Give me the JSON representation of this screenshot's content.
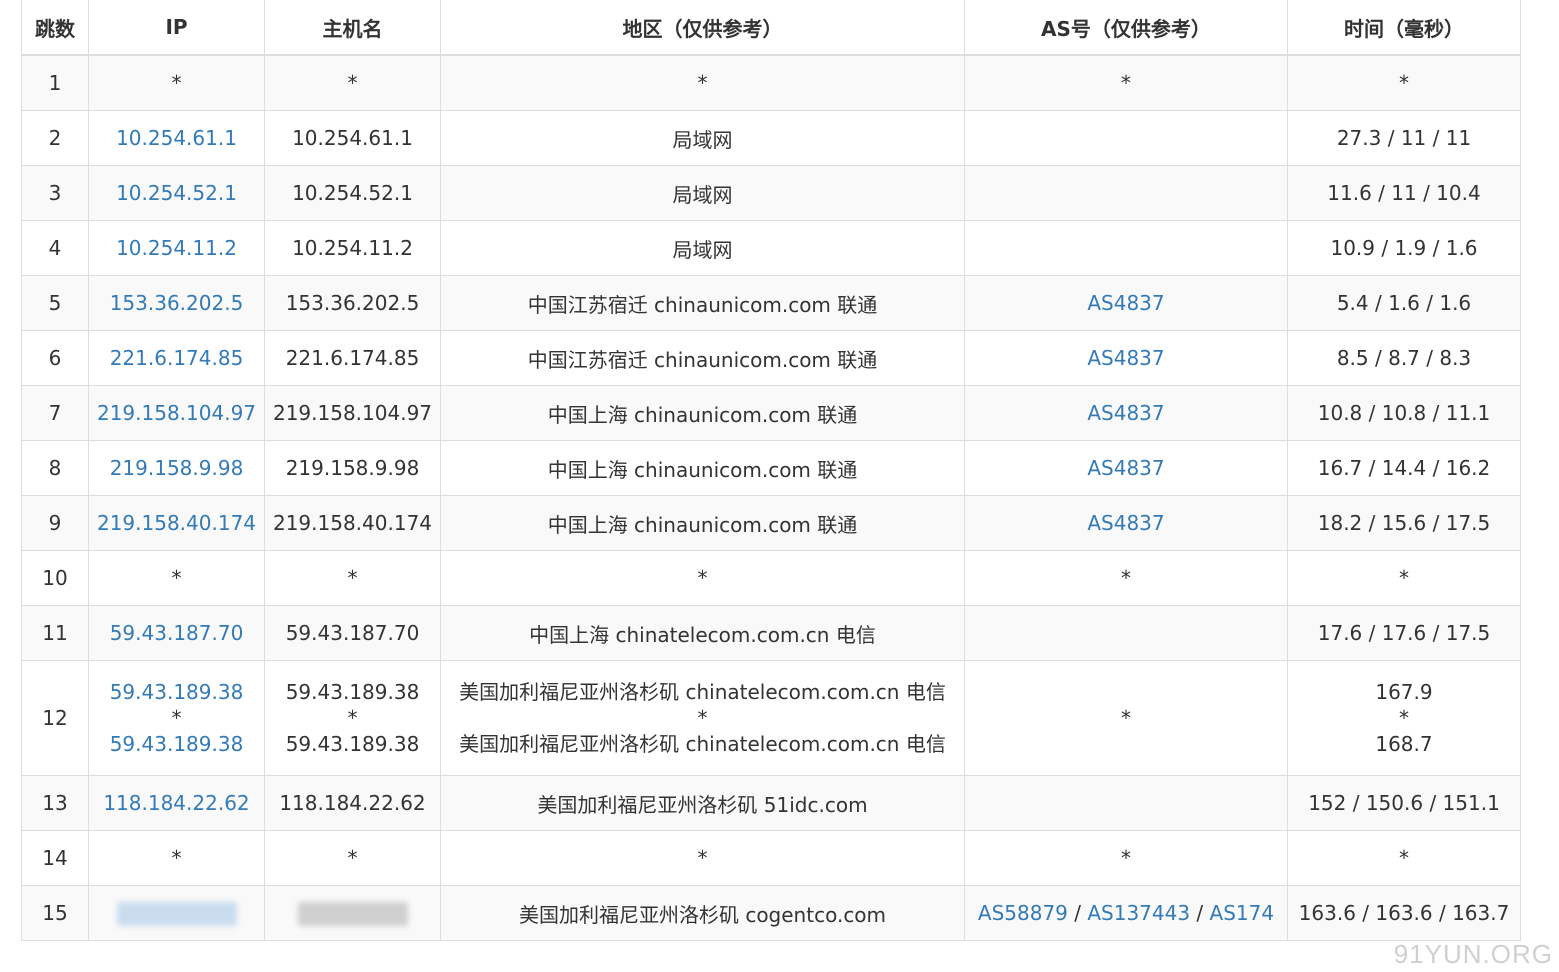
{
  "columns": [
    "跳数",
    "IP",
    "主机名",
    "地区（仅供参考）",
    "AS号（仅供参考）",
    "时间（毫秒）"
  ],
  "rows": [
    {
      "hop": "1",
      "ip": "*",
      "host": "*",
      "region": "*",
      "as": "*",
      "time": "*"
    },
    {
      "hop": "2",
      "ip": "10.254.61.1",
      "host": "10.254.61.1",
      "region": "局域网",
      "as": "",
      "time": "27.3 / 11 / 11"
    },
    {
      "hop": "3",
      "ip": "10.254.52.1",
      "host": "10.254.52.1",
      "region": "局域网",
      "as": "",
      "time": "11.6 / 11 / 10.4"
    },
    {
      "hop": "4",
      "ip": "10.254.11.2",
      "host": "10.254.11.2",
      "region": "局域网",
      "as": "",
      "time": "10.9 / 1.9 / 1.6"
    },
    {
      "hop": "5",
      "ip": "153.36.202.5",
      "host": "153.36.202.5",
      "region": "中国江苏宿迁 chinaunicom.com 联通",
      "as": "AS4837",
      "time": "5.4 / 1.6 / 1.6"
    },
    {
      "hop": "6",
      "ip": "221.6.174.85",
      "host": "221.6.174.85",
      "region": "中国江苏宿迁 chinaunicom.com 联通",
      "as": "AS4837",
      "time": "8.5 / 8.7 / 8.3"
    },
    {
      "hop": "7",
      "ip": "219.158.104.97",
      "host": "219.158.104.97",
      "region": "中国上海 chinaunicom.com 联通",
      "as": "AS4837",
      "time": "10.8 / 10.8 / 11.1"
    },
    {
      "hop": "8",
      "ip": "219.158.9.98",
      "host": "219.158.9.98",
      "region": "中国上海 chinaunicom.com 联通",
      "as": "AS4837",
      "time": "16.7 / 14.4 / 16.2"
    },
    {
      "hop": "9",
      "ip": "219.158.40.174",
      "host": "219.158.40.174",
      "region": "中国上海 chinaunicom.com 联通",
      "as": "AS4837",
      "time": "18.2 / 15.6 / 17.5"
    },
    {
      "hop": "10",
      "ip": "*",
      "host": "*",
      "region": "*",
      "as": "*",
      "time": "*"
    },
    {
      "hop": "11",
      "ip": "59.43.187.70",
      "host": "59.43.187.70",
      "region": "中国上海 chinatelecom.com.cn 电信",
      "as": "",
      "time": "17.6 / 17.6 / 17.5"
    },
    {
      "hop": "12",
      "ip": [
        "59.43.189.38",
        "*",
        "59.43.189.38"
      ],
      "host": [
        "59.43.189.38",
        "*",
        "59.43.189.38"
      ],
      "region": [
        "美国加利福尼亚州洛杉矶 chinatelecom.com.cn 电信",
        "*",
        "美国加利福尼亚州洛杉矶 chinatelecom.com.cn 电信"
      ],
      "as": "*",
      "time": [
        "167.9",
        "*",
        "168.7"
      ]
    },
    {
      "hop": "13",
      "ip": "118.184.22.62",
      "host": "118.184.22.62",
      "region": "美国加利福尼亚州洛杉矶 51idc.com",
      "as": "",
      "time": "152 / 150.6 / 151.1"
    },
    {
      "hop": "14",
      "ip": "*",
      "host": "*",
      "region": "*",
      "as": "*",
      "time": "*"
    },
    {
      "hop": "15",
      "ip_redacted": true,
      "host_redacted": true,
      "region": "美国加利福尼亚州洛杉矶 cogentco.com",
      "as": [
        "AS58879",
        "AS137443",
        "AS174"
      ],
      "as_separator": " / ",
      "time": "163.6 / 163.6 / 163.7"
    }
  ],
  "watermark": "91YUN.ORG",
  "colors": {
    "link": "#337ab7",
    "text": "#333333",
    "border": "#dddddd",
    "stripe": "#f9f9f9"
  }
}
